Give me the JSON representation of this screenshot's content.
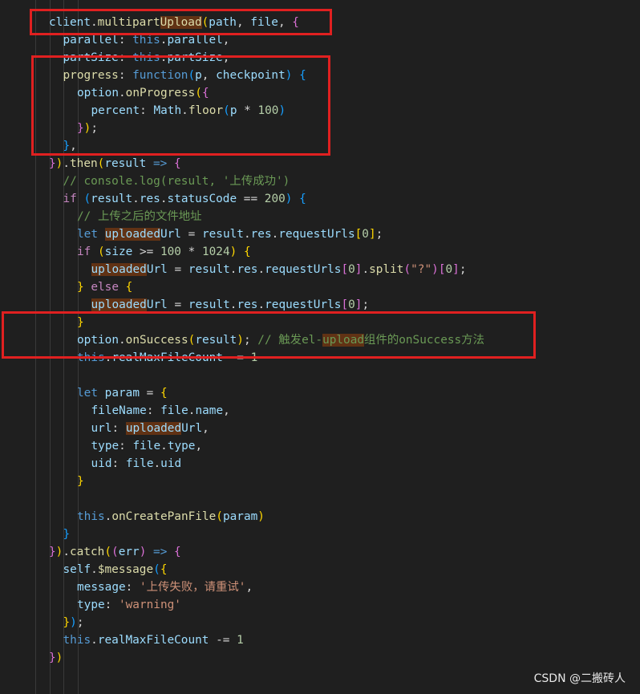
{
  "editor": {
    "lines": [
      {
        "indent": 1,
        "tokens": [
          {
            "t": "client",
            "c": "var"
          },
          {
            "t": ".",
            "c": "plain"
          },
          {
            "t": "multipart",
            "c": "fn"
          },
          {
            "t": "Upload",
            "c": "fn",
            "hl": true
          },
          {
            "t": "(",
            "c": "p1"
          },
          {
            "t": "path",
            "c": "var"
          },
          {
            "t": ", ",
            "c": "plain"
          },
          {
            "t": "file",
            "c": "var"
          },
          {
            "t": ", ",
            "c": "plain"
          },
          {
            "t": "{",
            "c": "p2"
          }
        ]
      },
      {
        "indent": 2,
        "tokens": [
          {
            "t": "parallel",
            "c": "var"
          },
          {
            "t": ": ",
            "c": "plain"
          },
          {
            "t": "this",
            "c": "kw"
          },
          {
            "t": ".",
            "c": "plain"
          },
          {
            "t": "parallel",
            "c": "var"
          },
          {
            "t": ",",
            "c": "plain"
          }
        ]
      },
      {
        "indent": 2,
        "tokens": [
          {
            "t": "partSize",
            "c": "var"
          },
          {
            "t": ": ",
            "c": "plain"
          },
          {
            "t": "this",
            "c": "kw"
          },
          {
            "t": ".",
            "c": "plain"
          },
          {
            "t": "partSize",
            "c": "var"
          },
          {
            "t": ",",
            "c": "plain"
          }
        ]
      },
      {
        "indent": 2,
        "tokens": [
          {
            "t": "progress",
            "c": "fn"
          },
          {
            "t": ": ",
            "c": "plain"
          },
          {
            "t": "function",
            "c": "kw"
          },
          {
            "t": "(",
            "c": "p3"
          },
          {
            "t": "p",
            "c": "var"
          },
          {
            "t": ", ",
            "c": "plain"
          },
          {
            "t": "checkpoint",
            "c": "var"
          },
          {
            "t": ")",
            "c": "p3"
          },
          {
            "t": " ",
            "c": "plain"
          },
          {
            "t": "{",
            "c": "p3"
          }
        ]
      },
      {
        "indent": 3,
        "tokens": [
          {
            "t": "option",
            "c": "var"
          },
          {
            "t": ".",
            "c": "plain"
          },
          {
            "t": "onProgress",
            "c": "fn"
          },
          {
            "t": "(",
            "c": "p1"
          },
          {
            "t": "{",
            "c": "p2"
          }
        ]
      },
      {
        "indent": 4,
        "tokens": [
          {
            "t": "percent",
            "c": "var"
          },
          {
            "t": ": ",
            "c": "plain"
          },
          {
            "t": "Math",
            "c": "var"
          },
          {
            "t": ".",
            "c": "plain"
          },
          {
            "t": "floor",
            "c": "fn"
          },
          {
            "t": "(",
            "c": "p3"
          },
          {
            "t": "p",
            "c": "var"
          },
          {
            "t": " * ",
            "c": "plain"
          },
          {
            "t": "100",
            "c": "num"
          },
          {
            "t": ")",
            "c": "p3"
          }
        ]
      },
      {
        "indent": 3,
        "tokens": [
          {
            "t": "}",
            "c": "p2"
          },
          {
            "t": ")",
            "c": "p1"
          },
          {
            "t": ";",
            "c": "plain"
          }
        ]
      },
      {
        "indent": 2,
        "tokens": [
          {
            "t": "}",
            "c": "p3"
          },
          {
            "t": ",",
            "c": "plain"
          }
        ]
      },
      {
        "indent": 1,
        "tokens": [
          {
            "t": "}",
            "c": "p2"
          },
          {
            "t": ")",
            "c": "p1"
          },
          {
            "t": ".",
            "c": "plain"
          },
          {
            "t": "then",
            "c": "fn"
          },
          {
            "t": "(",
            "c": "p1"
          },
          {
            "t": "result",
            "c": "var"
          },
          {
            "t": " ",
            "c": "plain"
          },
          {
            "t": "=>",
            "c": "kw"
          },
          {
            "t": " ",
            "c": "plain"
          },
          {
            "t": "{",
            "c": "p2"
          }
        ]
      },
      {
        "indent": 2,
        "tokens": [
          {
            "t": "// console.log(result, '上传成功')",
            "c": "cmt"
          }
        ]
      },
      {
        "indent": 2,
        "tokens": [
          {
            "t": "if",
            "c": "ctl"
          },
          {
            "t": " ",
            "c": "plain"
          },
          {
            "t": "(",
            "c": "p3"
          },
          {
            "t": "result",
            "c": "var"
          },
          {
            "t": ".",
            "c": "plain"
          },
          {
            "t": "res",
            "c": "var"
          },
          {
            "t": ".",
            "c": "plain"
          },
          {
            "t": "statusCode",
            "c": "var"
          },
          {
            "t": " == ",
            "c": "plain"
          },
          {
            "t": "200",
            "c": "num"
          },
          {
            "t": ")",
            "c": "p3"
          },
          {
            "t": " ",
            "c": "plain"
          },
          {
            "t": "{",
            "c": "p3"
          }
        ]
      },
      {
        "indent": 3,
        "tokens": [
          {
            "t": "// 上传之后的文件地址",
            "c": "cmt"
          }
        ]
      },
      {
        "indent": 3,
        "tokens": [
          {
            "t": "let",
            "c": "kw"
          },
          {
            "t": " ",
            "c": "plain"
          },
          {
            "t": "uploaded",
            "c": "var",
            "hl": true
          },
          {
            "t": "Url",
            "c": "var"
          },
          {
            "t": " = ",
            "c": "plain"
          },
          {
            "t": "result",
            "c": "var"
          },
          {
            "t": ".",
            "c": "plain"
          },
          {
            "t": "res",
            "c": "var"
          },
          {
            "t": ".",
            "c": "plain"
          },
          {
            "t": "requestUrls",
            "c": "var"
          },
          {
            "t": "[",
            "c": "p1"
          },
          {
            "t": "0",
            "c": "num"
          },
          {
            "t": "]",
            "c": "p1"
          },
          {
            "t": ";",
            "c": "plain"
          }
        ]
      },
      {
        "indent": 3,
        "tokens": [
          {
            "t": "if",
            "c": "ctl"
          },
          {
            "t": " ",
            "c": "plain"
          },
          {
            "t": "(",
            "c": "p1"
          },
          {
            "t": "size",
            "c": "var"
          },
          {
            "t": " >= ",
            "c": "plain"
          },
          {
            "t": "100",
            "c": "num"
          },
          {
            "t": " * ",
            "c": "plain"
          },
          {
            "t": "1024",
            "c": "num"
          },
          {
            "t": ")",
            "c": "p1"
          },
          {
            "t": " ",
            "c": "plain"
          },
          {
            "t": "{",
            "c": "p1"
          }
        ]
      },
      {
        "indent": 4,
        "tokens": [
          {
            "t": "uploaded",
            "c": "var",
            "hl": true
          },
          {
            "t": "Url",
            "c": "var"
          },
          {
            "t": " = ",
            "c": "plain"
          },
          {
            "t": "result",
            "c": "var"
          },
          {
            "t": ".",
            "c": "plain"
          },
          {
            "t": "res",
            "c": "var"
          },
          {
            "t": ".",
            "c": "plain"
          },
          {
            "t": "requestUrls",
            "c": "var"
          },
          {
            "t": "[",
            "c": "p2"
          },
          {
            "t": "0",
            "c": "num"
          },
          {
            "t": "]",
            "c": "p2"
          },
          {
            "t": ".",
            "c": "plain"
          },
          {
            "t": "split",
            "c": "fn"
          },
          {
            "t": "(",
            "c": "p2"
          },
          {
            "t": "\"?\"",
            "c": "str"
          },
          {
            "t": ")",
            "c": "p2"
          },
          {
            "t": "[",
            "c": "p2"
          },
          {
            "t": "0",
            "c": "num"
          },
          {
            "t": "]",
            "c": "p2"
          },
          {
            "t": ";",
            "c": "plain"
          }
        ]
      },
      {
        "indent": 3,
        "tokens": [
          {
            "t": "}",
            "c": "p1"
          },
          {
            "t": " ",
            "c": "plain"
          },
          {
            "t": "else",
            "c": "ctl"
          },
          {
            "t": " ",
            "c": "plain"
          },
          {
            "t": "{",
            "c": "p1"
          }
        ]
      },
      {
        "indent": 4,
        "tokens": [
          {
            "t": "uploaded",
            "c": "var",
            "hl": true
          },
          {
            "t": "Url",
            "c": "var"
          },
          {
            "t": " = ",
            "c": "plain"
          },
          {
            "t": "result",
            "c": "var"
          },
          {
            "t": ".",
            "c": "plain"
          },
          {
            "t": "res",
            "c": "var"
          },
          {
            "t": ".",
            "c": "plain"
          },
          {
            "t": "requestUrls",
            "c": "var"
          },
          {
            "t": "[",
            "c": "p2"
          },
          {
            "t": "0",
            "c": "num"
          },
          {
            "t": "]",
            "c": "p2"
          },
          {
            "t": ";",
            "c": "plain"
          }
        ]
      },
      {
        "indent": 3,
        "tokens": [
          {
            "t": "}",
            "c": "p1"
          }
        ]
      },
      {
        "indent": 3,
        "tokens": [
          {
            "t": "option",
            "c": "var"
          },
          {
            "t": ".",
            "c": "plain"
          },
          {
            "t": "onSuccess",
            "c": "fn"
          },
          {
            "t": "(",
            "c": "p1"
          },
          {
            "t": "result",
            "c": "var"
          },
          {
            "t": ")",
            "c": "p1"
          },
          {
            "t": "; ",
            "c": "plain"
          },
          {
            "t": "// 触发el-",
            "c": "cmt"
          },
          {
            "t": "upload",
            "c": "cmt",
            "hl": true
          },
          {
            "t": "组件的onSuccess方法",
            "c": "cmt"
          }
        ]
      },
      {
        "indent": 3,
        "tokens": [
          {
            "t": "this",
            "c": "kw"
          },
          {
            "t": ".",
            "c": "plain"
          },
          {
            "t": "realMaxFileCount",
            "c": "var"
          },
          {
            "t": " -= ",
            "c": "plain"
          },
          {
            "t": "1",
            "c": "num"
          }
        ]
      },
      {
        "indent": 0,
        "tokens": []
      },
      {
        "indent": 3,
        "tokens": [
          {
            "t": "let",
            "c": "kw"
          },
          {
            "t": " ",
            "c": "plain"
          },
          {
            "t": "param",
            "c": "var"
          },
          {
            "t": " = ",
            "c": "plain"
          },
          {
            "t": "{",
            "c": "p1"
          }
        ]
      },
      {
        "indent": 4,
        "tokens": [
          {
            "t": "fileName",
            "c": "var"
          },
          {
            "t": ": ",
            "c": "plain"
          },
          {
            "t": "file",
            "c": "var"
          },
          {
            "t": ".",
            "c": "plain"
          },
          {
            "t": "name",
            "c": "var"
          },
          {
            "t": ",",
            "c": "plain"
          }
        ]
      },
      {
        "indent": 4,
        "tokens": [
          {
            "t": "url",
            "c": "var"
          },
          {
            "t": ": ",
            "c": "plain"
          },
          {
            "t": "uploaded",
            "c": "var",
            "hl": true
          },
          {
            "t": "Url",
            "c": "var"
          },
          {
            "t": ",",
            "c": "plain"
          }
        ]
      },
      {
        "indent": 4,
        "tokens": [
          {
            "t": "type",
            "c": "var"
          },
          {
            "t": ": ",
            "c": "plain"
          },
          {
            "t": "file",
            "c": "var"
          },
          {
            "t": ".",
            "c": "plain"
          },
          {
            "t": "type",
            "c": "var"
          },
          {
            "t": ",",
            "c": "plain"
          }
        ]
      },
      {
        "indent": 4,
        "tokens": [
          {
            "t": "uid",
            "c": "var"
          },
          {
            "t": ": ",
            "c": "plain"
          },
          {
            "t": "file",
            "c": "var"
          },
          {
            "t": ".",
            "c": "plain"
          },
          {
            "t": "uid",
            "c": "var"
          }
        ]
      },
      {
        "indent": 3,
        "tokens": [
          {
            "t": "}",
            "c": "p1"
          }
        ]
      },
      {
        "indent": 0,
        "tokens": []
      },
      {
        "indent": 3,
        "tokens": [
          {
            "t": "this",
            "c": "kw"
          },
          {
            "t": ".",
            "c": "plain"
          },
          {
            "t": "onCreatePanFile",
            "c": "fn"
          },
          {
            "t": "(",
            "c": "p1"
          },
          {
            "t": "param",
            "c": "var"
          },
          {
            "t": ")",
            "c": "p1"
          }
        ]
      },
      {
        "indent": 2,
        "tokens": [
          {
            "t": "}",
            "c": "p3"
          }
        ]
      },
      {
        "indent": 1,
        "tokens": [
          {
            "t": "}",
            "c": "p2"
          },
          {
            "t": ")",
            "c": "p1"
          },
          {
            "t": ".",
            "c": "plain"
          },
          {
            "t": "catch",
            "c": "fn"
          },
          {
            "t": "(",
            "c": "p1"
          },
          {
            "t": "(",
            "c": "p2"
          },
          {
            "t": "err",
            "c": "var"
          },
          {
            "t": ")",
            "c": "p2"
          },
          {
            "t": " ",
            "c": "plain"
          },
          {
            "t": "=>",
            "c": "kw"
          },
          {
            "t": " ",
            "c": "plain"
          },
          {
            "t": "{",
            "c": "p2"
          }
        ]
      },
      {
        "indent": 2,
        "tokens": [
          {
            "t": "self",
            "c": "var"
          },
          {
            "t": ".",
            "c": "plain"
          },
          {
            "t": "$message",
            "c": "fn"
          },
          {
            "t": "(",
            "c": "p3"
          },
          {
            "t": "{",
            "c": "p1"
          }
        ]
      },
      {
        "indent": 3,
        "tokens": [
          {
            "t": "message",
            "c": "var"
          },
          {
            "t": ": ",
            "c": "plain"
          },
          {
            "t": "'上传失败，请重试'",
            "c": "str"
          },
          {
            "t": ",",
            "c": "plain"
          }
        ]
      },
      {
        "indent": 3,
        "tokens": [
          {
            "t": "type",
            "c": "var"
          },
          {
            "t": ": ",
            "c": "plain"
          },
          {
            "t": "'warning'",
            "c": "str"
          }
        ]
      },
      {
        "indent": 2,
        "tokens": [
          {
            "t": "}",
            "c": "p1"
          },
          {
            "t": ")",
            "c": "p3"
          },
          {
            "t": ";",
            "c": "plain"
          }
        ]
      },
      {
        "indent": 2,
        "tokens": [
          {
            "t": "this",
            "c": "kw"
          },
          {
            "t": ".",
            "c": "plain"
          },
          {
            "t": "realMaxFileCount",
            "c": "var"
          },
          {
            "t": " -= ",
            "c": "plain"
          },
          {
            "t": "1",
            "c": "num"
          }
        ]
      },
      {
        "indent": 1,
        "tokens": [
          {
            "t": "}",
            "c": "p2"
          },
          {
            "t": ")",
            "c": "p1"
          }
        ]
      }
    ]
  },
  "colors": {
    "background": "#1f1f1f",
    "annotation_box": "#e02020",
    "word_highlight": "#613214"
  },
  "watermark": "CSDN @二搬砖人"
}
